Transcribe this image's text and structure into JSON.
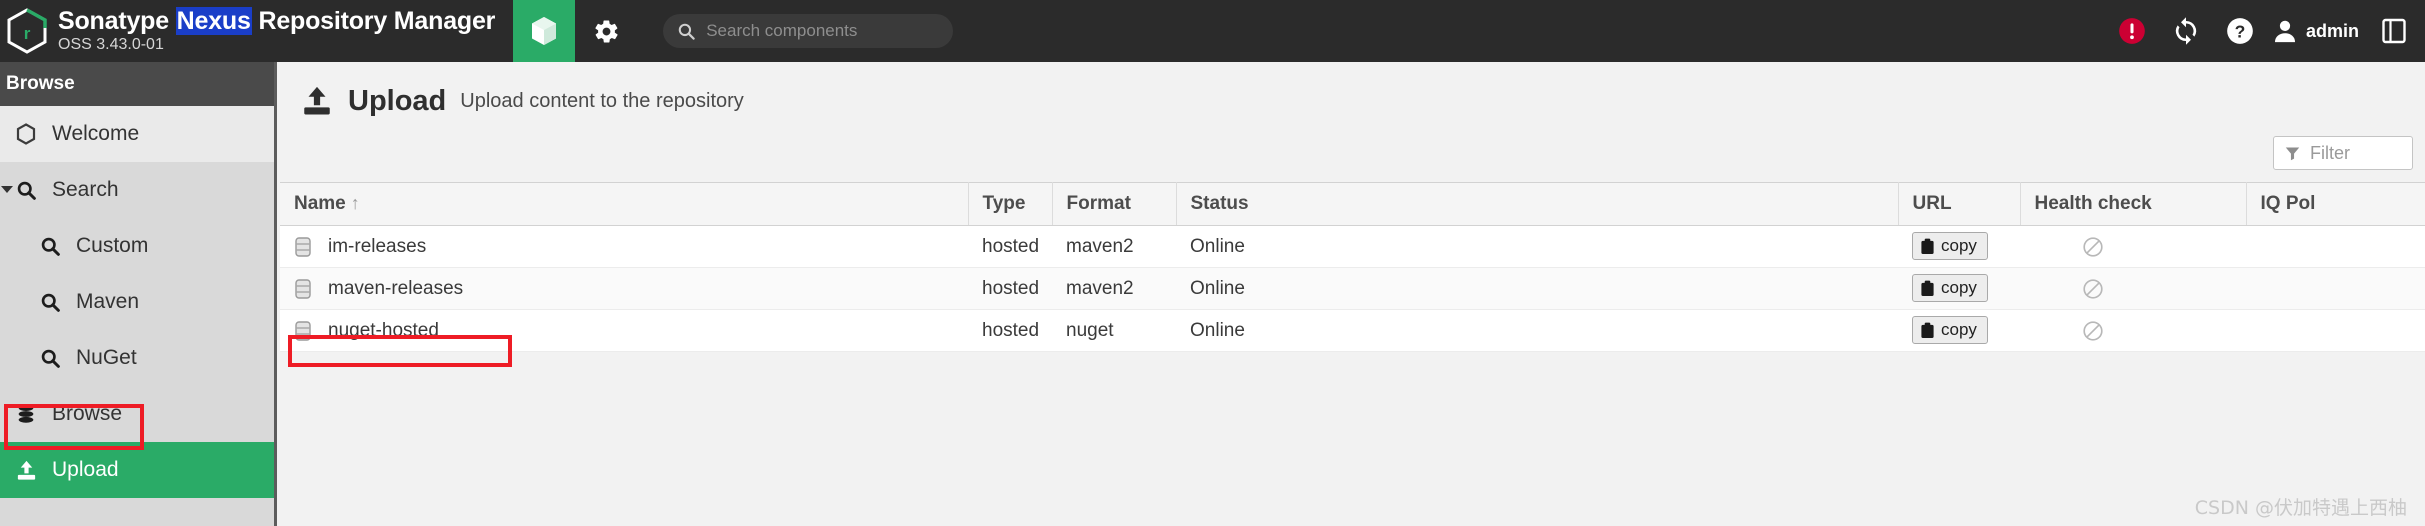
{
  "header": {
    "brand_prefix": "Sonatype ",
    "brand_selected": "Nexus",
    "brand_suffix": " Repository Manager",
    "version": "OSS 3.43.0-01",
    "browse_tab_icon": "box-icon",
    "settings_tab_icon": "gear-icon",
    "search": {
      "icon": "search-icon",
      "value": "",
      "placeholder": "Search components"
    },
    "alert_icon": "alert-circle-icon",
    "sync_icon": "refresh-sync-icon",
    "help_icon": "help-circle-icon",
    "user_icon": "user-avatar-icon",
    "user_name": "admin",
    "extra_icon": "panel-icon"
  },
  "sidebar": {
    "section_title": "Browse",
    "items": [
      {
        "label": "Welcome",
        "icon": "hexagon-icon",
        "state": "hover",
        "indent": 0
      },
      {
        "label": "Search",
        "icon": "search-icon",
        "state": "expanded",
        "indent": 0
      },
      {
        "label": "Custom",
        "icon": "search-icon",
        "state": "normal",
        "indent": 1
      },
      {
        "label": "Maven",
        "icon": "search-icon",
        "state": "normal",
        "indent": 1
      },
      {
        "label": "NuGet",
        "icon": "search-icon",
        "state": "normal",
        "indent": 1
      },
      {
        "label": "Browse",
        "icon": "database-icon",
        "state": "normal",
        "indent": 0
      },
      {
        "label": "Upload",
        "icon": "upload-icon",
        "state": "active",
        "indent": 0
      }
    ]
  },
  "main": {
    "page_icon": "upload-icon",
    "title": "Upload",
    "subtitle": "Upload content to the repository",
    "filter": {
      "icon": "funnel-icon",
      "value": "",
      "placeholder": "Filter"
    },
    "table": {
      "columns": [
        {
          "label": "Name",
          "sort": "↑"
        },
        {
          "label": "Type",
          "sort": ""
        },
        {
          "label": "Format",
          "sort": ""
        },
        {
          "label": "Status",
          "sort": ""
        },
        {
          "label": "URL",
          "sort": ""
        },
        {
          "label": "Health check",
          "sort": ""
        },
        {
          "label": "IQ Pol",
          "sort": ""
        }
      ],
      "rows": [
        {
          "icon": "repository-icon",
          "name": "im-releases",
          "type": "hosted",
          "format": "maven2",
          "status": "Online",
          "url_label": "copy",
          "url_icon": "clipboard-icon",
          "health_icon": "no-entry-icon",
          "iq": ""
        },
        {
          "icon": "repository-icon",
          "name": "maven-releases",
          "type": "hosted",
          "format": "maven2",
          "status": "Online",
          "url_label": "copy",
          "url_icon": "clipboard-icon",
          "health_icon": "no-entry-icon",
          "iq": ""
        },
        {
          "icon": "repository-icon",
          "name": "nuget-hosted",
          "type": "hosted",
          "format": "nuget",
          "status": "Online",
          "url_label": "copy",
          "url_icon": "clipboard-icon",
          "health_icon": "no-entry-icon",
          "iq": ""
        }
      ]
    }
  },
  "watermark": "CSDN @伏加特遇上西柚",
  "colors": {
    "header_bg": "#2b2b2b",
    "accent_green": "#2aab67",
    "sidebar_bg": "#d9d9d9",
    "annotation_red": "#ee1c25",
    "selection_blue": "#1a3ec8",
    "alert_red": "#cc0033"
  }
}
